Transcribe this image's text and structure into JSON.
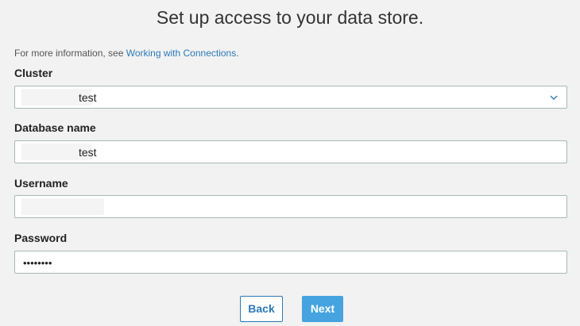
{
  "page": {
    "title": "Set up access to your data store."
  },
  "info": {
    "prefix": "For more information, see ",
    "link_text": "Working with Connections",
    "suffix": "."
  },
  "fields": {
    "cluster": {
      "label": "Cluster",
      "value": "test",
      "icon": "chevron-down-icon"
    },
    "database": {
      "label": "Database name",
      "value": "test"
    },
    "username": {
      "label": "Username",
      "value": ""
    },
    "password": {
      "label": "Password",
      "value": "••••••••"
    }
  },
  "buttons": {
    "back_label": "Back",
    "next_label": "Next"
  },
  "colors": {
    "background": "#f2f2f2",
    "link": "#2a7ab8",
    "primary_button": "#46a3e0",
    "input_border": "#aab7b8"
  }
}
